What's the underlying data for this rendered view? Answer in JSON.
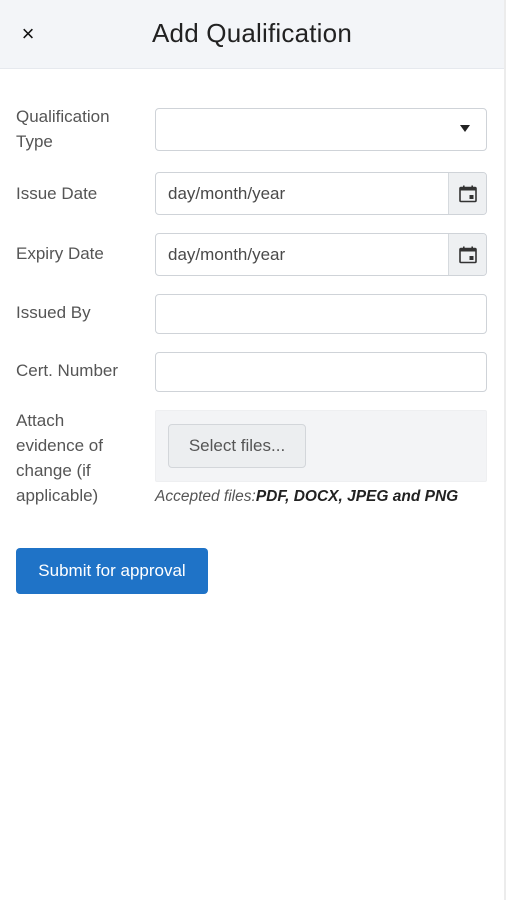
{
  "header": {
    "title": "Add Qualification",
    "close_symbol": "×"
  },
  "form": {
    "qualification_type": {
      "label": "Qualification Type",
      "value": ""
    },
    "issue_date": {
      "label": "Issue Date",
      "placeholder": "day/month/year"
    },
    "expiry_date": {
      "label": "Expiry Date",
      "placeholder": "day/month/year"
    },
    "issued_by": {
      "label": "Issued By",
      "value": ""
    },
    "cert_number": {
      "label": "Cert. Number",
      "value": ""
    },
    "attach": {
      "label": "Attach evidence of change (if applicable)",
      "button": "Select files...",
      "hint_prefix": "Accepted files:",
      "hint_formats": "PDF, DOCX, JPEG and PNG"
    },
    "submit_label": "Submit for approval"
  },
  "colors": {
    "accent": "#1f73c7",
    "header_bg": "#f3f5f8"
  }
}
